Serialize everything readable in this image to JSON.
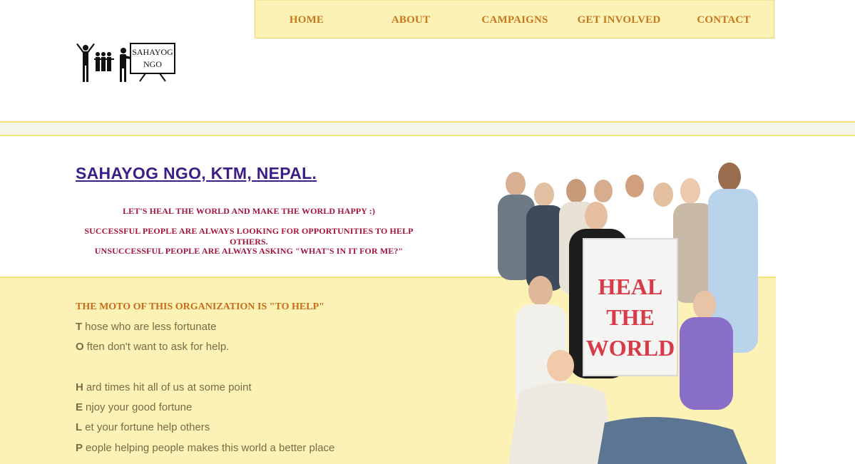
{
  "nav": {
    "items": [
      {
        "label": "HOME"
      },
      {
        "label": "ABOUT"
      },
      {
        "label": "CAMPAIGNS"
      },
      {
        "label": "GET INVOLVED"
      },
      {
        "label": "CONTACT"
      }
    ]
  },
  "logo": {
    "line1": "SAHAYOG",
    "line2": "NGO"
  },
  "header": {
    "title": "SAHAYOG NGO, KTM, NEPAL."
  },
  "taglines": [
    "LET'S HEAL THE WORLD AND MAKE THE WORLD HAPPY :)",
    "SUCCESSFUL PEOPLE ARE ALWAYS LOOKING FOR OPPORTUNITIES TO HELP OTHERS.",
    "UNSUCCESSFUL PEOPLE ARE ALWAYS ASKING \"WHAT'S IN IT FOR ME?\""
  ],
  "moto": {
    "heading": "THE MOTO OF THIS ORGANIZATION IS \"TO HELP\"",
    "lines": [
      {
        "cap": "T",
        "rest": "hose who are less fortunate"
      },
      {
        "cap": "O",
        "rest": "ften don't want to ask for help."
      },
      {
        "cap": "H",
        "rest": "ard times hit all of us at some point"
      },
      {
        "cap": "E",
        "rest": "njoy your good fortune"
      },
      {
        "cap": "L",
        "rest": "et your fortune help others"
      },
      {
        "cap": "P",
        "rest": "eople helping people makes this world a better place"
      }
    ]
  },
  "hero": {
    "sign": [
      "HEAL",
      "THE",
      "WORLD"
    ]
  },
  "colors": {
    "nav_bg": "#fdf2b6",
    "nav_text": "#c5771c",
    "title": "#3b1f86",
    "tagline": "#a3163a",
    "moto": "#c96b18",
    "sign_text": "#d93a4a"
  }
}
